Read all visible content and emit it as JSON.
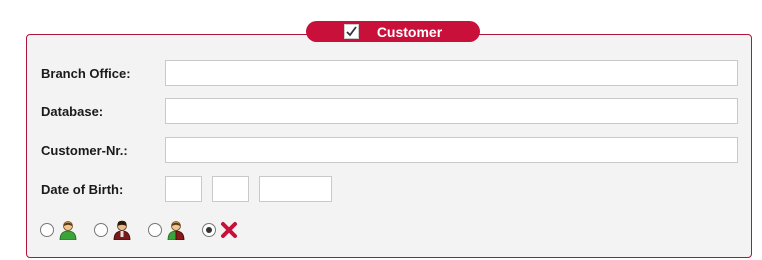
{
  "legend": {
    "title": "Customer",
    "checked": true
  },
  "form": {
    "branch_office_label": "Branch Office:",
    "database_label": "Database:",
    "customer_nr_label": "Customer-Nr.:",
    "date_of_birth_label": "Date of Birth:",
    "branch_office_value": "",
    "database_value": "",
    "customer_nr_value": "",
    "dob_day": "",
    "dob_month": "",
    "dob_year": ""
  },
  "gender_options": [
    {
      "icon": "person-green-icon",
      "selected": false
    },
    {
      "icon": "person-dark-red-icon",
      "selected": false
    },
    {
      "icon": "person-green-red-icon",
      "selected": false
    },
    {
      "icon": "red-x-icon",
      "selected": true
    }
  ],
  "colors": {
    "accent": "#c8103a",
    "border": "#b0163b",
    "panel_bg": "#f3f3f3"
  }
}
